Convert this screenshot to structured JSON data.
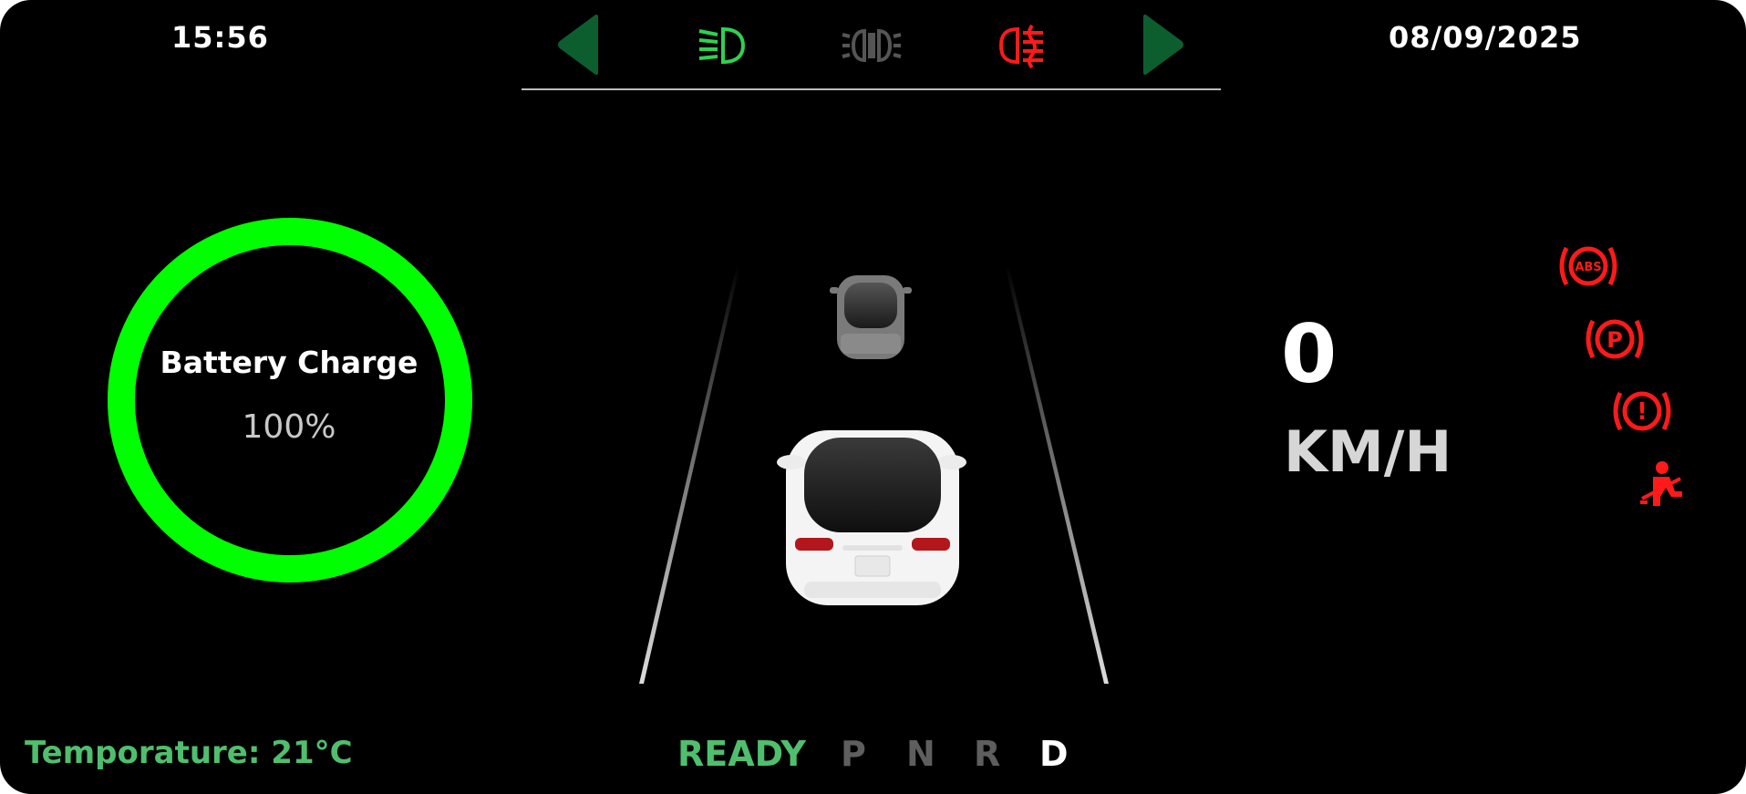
{
  "status": {
    "time": "15:56",
    "date": "08/09/2025"
  },
  "battery": {
    "label": "Battery Charge",
    "value_text": "100%",
    "level": 1.0,
    "ring_color": "#00ff00"
  },
  "speed": {
    "value": "0",
    "unit": "KM/H"
  },
  "temperature": {
    "text": "Temporature: 21°C"
  },
  "drive": {
    "ready_label": "READY",
    "gears": [
      "P",
      "N",
      "R",
      "D"
    ],
    "selected_gear": "D"
  },
  "indicators": {
    "left_turn": {
      "icon": "left-turn-arrow-icon",
      "color": "#0d5e2f"
    },
    "right_turn": {
      "icon": "right-turn-arrow-icon",
      "color": "#0d5e2f"
    },
    "low_beam": {
      "icon": "low-beam-headlight-icon",
      "color": "#2fd14f"
    },
    "parking_lights": {
      "icon": "parking-lights-icon",
      "color": "#555555"
    },
    "rear_fog": {
      "icon": "rear-fog-light-icon",
      "color": "#ff1a1a"
    }
  },
  "warnings": [
    {
      "icon": "abs-warning-icon",
      "text": "ABS",
      "color": "#ff1a1a"
    },
    {
      "icon": "parking-brake-icon",
      "text": "P",
      "color": "#ff1a1a"
    },
    {
      "icon": "brake-warning-icon",
      "text": "!",
      "color": "#ff1a1a"
    },
    {
      "icon": "seatbelt-warning-icon",
      "color": "#ff1a1a"
    }
  ],
  "colors": {
    "background": "#000000",
    "accent_green": "#4fbf6d"
  }
}
